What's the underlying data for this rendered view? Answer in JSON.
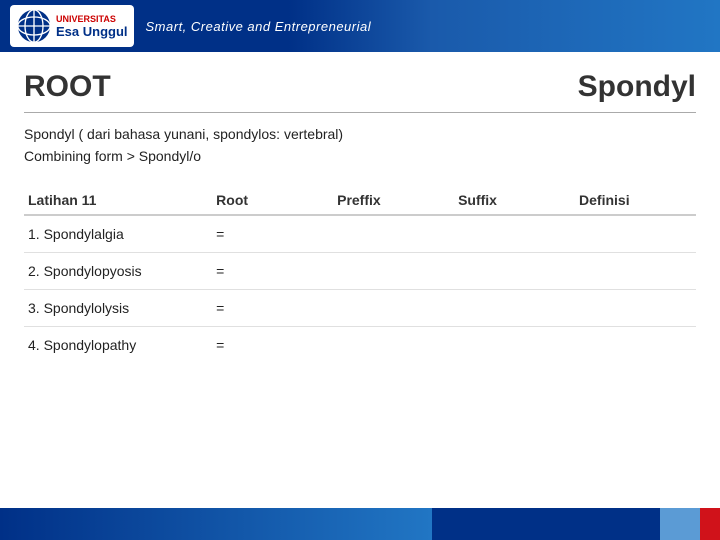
{
  "header": {
    "logo_text": "Esa Unggul",
    "tagline": "Smart, Creative and Entrepreneurial"
  },
  "main": {
    "root_label": "ROOT",
    "spondyl_label": "Spondyl",
    "description_line1": "Spondyl ( dari bahasa yunani, spondylos: vertebral)",
    "description_line2": "Combining form  > Spondyl/o",
    "table": {
      "headers": [
        "Latihan 11",
        "Root",
        "Preffix",
        "Suffix",
        "Definisi"
      ],
      "rows": [
        {
          "latihan": "1. Spondylalgia",
          "root": "=",
          "prefix": "",
          "suffix": "",
          "definisi": ""
        },
        {
          "latihan": "2. Spondylopyosis",
          "root": "=",
          "prefix": "",
          "suffix": "",
          "definisi": ""
        },
        {
          "latihan": "3. Spondylolysis",
          "root": "=",
          "prefix": "",
          "suffix": "",
          "definisi": ""
        },
        {
          "latihan": "4. Spondylopathy",
          "root": "=",
          "prefix": "",
          "suffix": "",
          "definisi": ""
        }
      ]
    }
  }
}
